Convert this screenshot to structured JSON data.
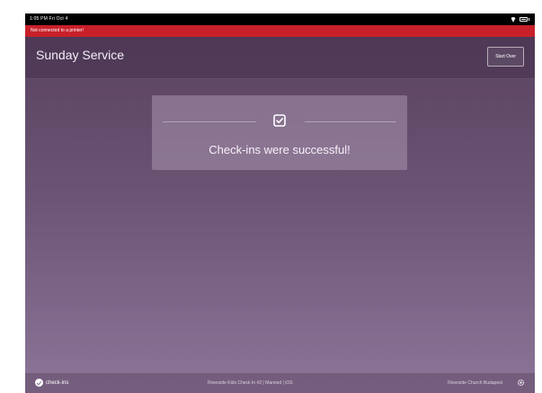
{
  "status_bar": {
    "time_date": "1:05 PM   Fri Oct 4"
  },
  "printer_alert": {
    "text": "Not connected to a printer!"
  },
  "header": {
    "title": "Sunday Service",
    "start_over_label": "Start Over"
  },
  "success_card": {
    "message": "Check-ins were successful!"
  },
  "footer": {
    "app_name": "check-ins",
    "center_text": "Riverside Kids Check In #2 | Manned | iOS",
    "right_text": "Riverside Church Budapest"
  },
  "icons": {
    "success": "checkbox-check-icon",
    "logo": "check-ins-logo-icon",
    "settings": "gear-icon",
    "wifi": "wifi-icon",
    "battery": "battery-icon"
  },
  "colors": {
    "printer_alert_bg": "#c8202a",
    "background_top": "#57405c",
    "background_bottom": "#8c7598"
  }
}
